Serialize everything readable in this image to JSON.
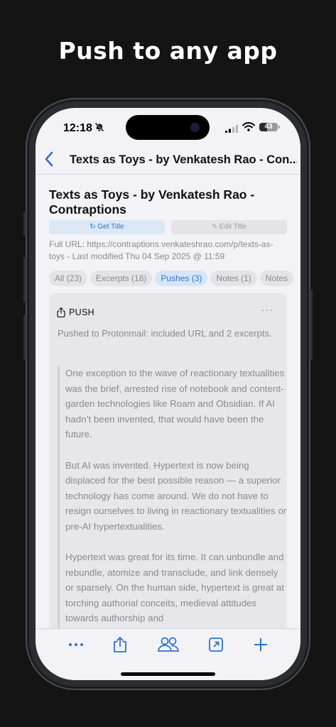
{
  "headline": "Push to any app",
  "status_bar": {
    "time": "12:18",
    "battery": "43",
    "battery_level": 0.43
  },
  "nav": {
    "title": "Texts as Toys - by Venkatesh Rao - Con..."
  },
  "page": {
    "title": "Texts as Toys - by Venkatesh Rao - Contraptions",
    "get_title_label": "↻ Get Title",
    "edit_title_label": "✎ Edit Title",
    "meta": "Full URL: https://contraptions.venkateshrao.com/p/texts-as-toys - Last modified Thu 04 Sep 2025 @ 11:59"
  },
  "tabs": [
    {
      "label": "All (23)",
      "active": false
    },
    {
      "label": "Excerpts (18)",
      "active": false
    },
    {
      "label": "Pushes (3)",
      "active": true
    },
    {
      "label": "Notes (1)",
      "active": false
    },
    {
      "label": "Notes",
      "active": false
    }
  ],
  "card": {
    "title": "PUSH",
    "more_label": "···",
    "description": "Pushed to Protonmail: included URL and 2 excerpts.",
    "quotes": [
      "One exception to the wave of reactionary textualities was the brief, arrested rise of notebook and content-garden technologies like Roam and Obsidian. If AI hadn’t been invented, that would have been the future.",
      "But AI was invented. Hypertext is now being displaced for the best possible reason — a superior technology has come around. We do not have to resign ourselves to living in reactionary textualities or pre-AI hypertextualities.",
      "Hypertext was great for its time. It can unbundle and rebundle, atomize and transclude, and link densely or sparsely. On the human side, hypertext is great at torching authorial conceits, medieval attitudes towards authorship and"
    ]
  },
  "toolbar": {
    "items": [
      {
        "icon": "more-icon"
      },
      {
        "icon": "share-icon"
      },
      {
        "icon": "people-icon"
      },
      {
        "icon": "open-external-icon"
      },
      {
        "icon": "add-icon"
      }
    ]
  },
  "colors": {
    "accent": "#2e72c8",
    "background": "#141414",
    "screen": "#f2f2f7"
  }
}
